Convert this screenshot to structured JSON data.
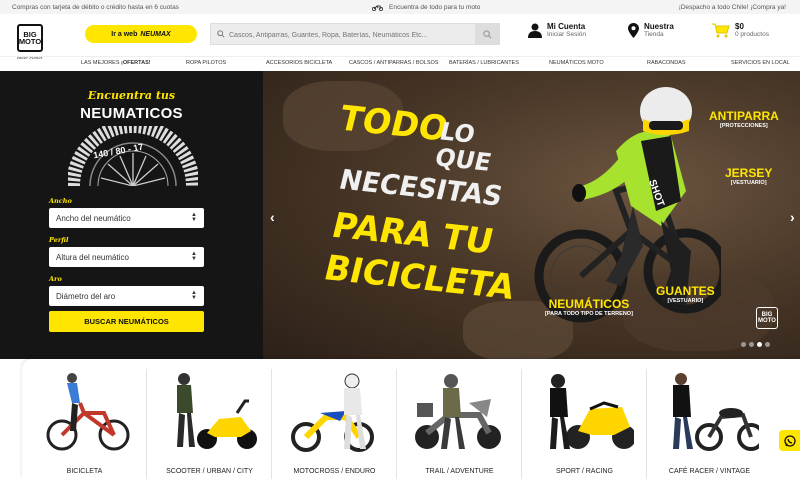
{
  "topbar": {
    "left": "Compras con tarjeta de débito o crédito hasta en 6 cuotas",
    "center": "Encuentra de todo para tu moto",
    "right": "¡Despacho a todo Chile! ¡Compra ya!"
  },
  "header": {
    "logo_line1": "BIG",
    "logo_line2": "MOTO",
    "logo_sub": "Rider Planet",
    "neumax_prefix": "Ir a web",
    "neumax_brand": "NEUMAX",
    "search_placeholder": "Cascos, Antiparras, Guantes, Ropa, Baterías, Neumáticos Etc...",
    "account_title": "Mi Cuenta",
    "account_sub": "Iniciar Sesión",
    "store_title": "Nuestra",
    "store_sub": "Tienda",
    "cart_total": "$0",
    "cart_count": "0 productos"
  },
  "nav": {
    "items": [
      {
        "pre": "LAS MEJORES ",
        "bold": "¡OFERTAS!"
      },
      {
        "pre": "ROPA PILOTOS",
        "bold": ""
      },
      {
        "pre": "ACCESORIOS BICICLETA",
        "bold": ""
      },
      {
        "pre": "CASCOS / ANTIPARRAS / BOLSOS",
        "bold": ""
      },
      {
        "pre": "BATERÍAS / LUBRICANTES",
        "bold": ""
      },
      {
        "pre": "NEUMÁTICOS MOTO",
        "bold": ""
      },
      {
        "pre": "RABACONDAS",
        "bold": ""
      },
      {
        "pre": "SERVICIOS EN LOCAL",
        "bold": ""
      }
    ]
  },
  "finder": {
    "title1": "Encuentra tus",
    "title2": "NEUMATICOS",
    "tire_size": "140 / 80 - 17",
    "ancho_label": "Ancho",
    "ancho_value": "Ancho del neumático",
    "perfil_label": "Perfil",
    "perfil_value": "Altura del neumático",
    "aro_label": "Aro",
    "aro_value": "Diámetro del aro",
    "button": "BUSCAR NEUMÁTICOS"
  },
  "hero": {
    "line1a": "TODO",
    "line1b": "LO",
    "line2": "QUE",
    "line3": "NECESITAS",
    "line4": "PARA TU",
    "line5": "BICICLETA",
    "tags": [
      {
        "title": "ANTIPARRA",
        "sub": "[PROTECCIONES]"
      },
      {
        "title": "JERSEY",
        "sub": "[VESTUARIO]"
      },
      {
        "title": "GUANTES",
        "sub": "[VESTUARIO]"
      },
      {
        "title": "NEUMÁTICOS",
        "sub": "[PARA TODO TIPO DE TERRENO]"
      }
    ],
    "logo_line1": "BIG",
    "logo_line2": "MOTO",
    "dots_total": 4,
    "dots_active": 3
  },
  "categories": [
    {
      "label": "BICICLETA"
    },
    {
      "label": "SCOOTER / URBAN / CITY"
    },
    {
      "label": "MOTOCROSS / ENDURO"
    },
    {
      "label": "TRAIL / ADVENTURE"
    },
    {
      "label": "SPORT / RACING"
    },
    {
      "label": "CAFÉ RACER / VINTAGE"
    }
  ],
  "colors": {
    "accent": "#ffe600",
    "dark": "#151515",
    "hero_lime": "#a6e22e"
  }
}
